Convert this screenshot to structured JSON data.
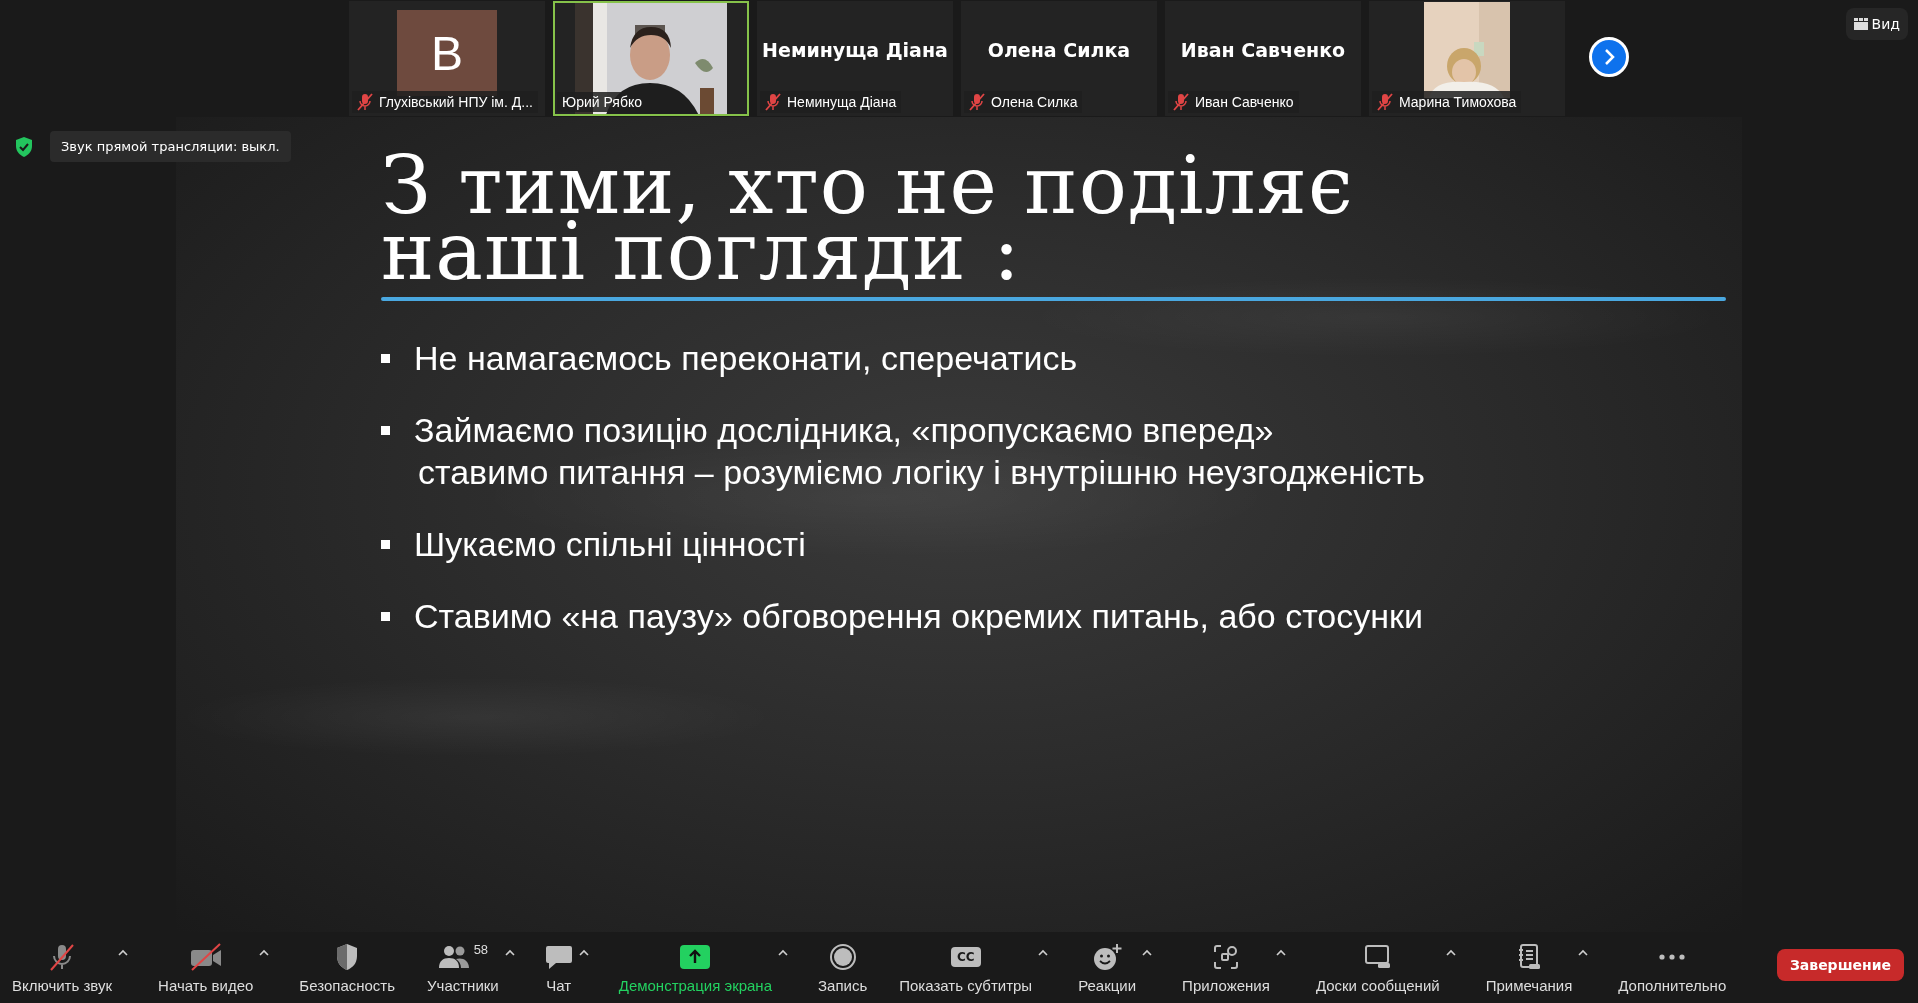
{
  "participants": [
    {
      "kind": "avatar",
      "letter": "B",
      "label": "Глухівський НПУ ім. Д...",
      "muted": true,
      "selected": false
    },
    {
      "kind": "video",
      "label": "Юрий Рябко",
      "muted": false,
      "selected": true
    },
    {
      "kind": "name",
      "display_name": "Неминуща Діана",
      "label": "Неминуща Діана",
      "muted": true,
      "selected": false
    },
    {
      "kind": "name",
      "display_name": "Олена Силка",
      "label": "Олена Силка",
      "muted": true,
      "selected": false
    },
    {
      "kind": "name",
      "display_name": "Иван Савченко",
      "label": "Иван Савченко",
      "muted": true,
      "selected": false
    },
    {
      "kind": "portrait",
      "label": "Марина Тимохова",
      "muted": true,
      "selected": false
    }
  ],
  "view_button": "Вид",
  "notice": "Звук прямой трансляции: выкл.",
  "slide": {
    "title_lines": [
      "З тими, хто не поділяє",
      "наші погляди :"
    ],
    "bullets": [
      {
        "lines": [
          "Не намагаємось переконати, сперечатись"
        ]
      },
      {
        "lines": [
          "Займаємо позицію дослідника, «пропускаємо вперед»",
          "ставимо питання – розуміємо логіку і внутрішню неузгодженість"
        ]
      },
      {
        "lines": [
          "Шукаємо спільні цінності"
        ]
      },
      {
        "lines": [
          "Ставимо «на паузу» обговорення окремих питань, або стосунки"
        ]
      }
    ]
  },
  "toolbar": [
    {
      "kind": "mic-muted",
      "label": "Включить звук",
      "caret": true,
      "highlighted": false
    },
    {
      "kind": "camera-muted",
      "label": "Начать видео",
      "caret": true,
      "highlighted": false
    },
    {
      "kind": "shield",
      "label": "Безопасность",
      "caret": false,
      "highlighted": false
    },
    {
      "kind": "people",
      "label": "Участники",
      "badge": "58",
      "caret": true,
      "highlighted": false
    },
    {
      "kind": "chat",
      "label": "Чат",
      "caret": true,
      "highlighted": false
    },
    {
      "kind": "share",
      "label": "Демонстрация экрана",
      "caret": true,
      "highlighted": true
    },
    {
      "kind": "record",
      "label": "Запись",
      "caret": false,
      "highlighted": false
    },
    {
      "kind": "cc",
      "icon_text": "CC",
      "label": "Показать субтитры",
      "caret": true,
      "highlighted": false
    },
    {
      "kind": "reactions",
      "label": "Реакции",
      "caret": true,
      "highlighted": false
    },
    {
      "kind": "apps",
      "label": "Приложения",
      "caret": true,
      "highlighted": false
    },
    {
      "kind": "whiteboard",
      "label": "Доски сообщений",
      "caret": true,
      "highlighted": false
    },
    {
      "kind": "notes",
      "label": "Примечания",
      "caret": true,
      "highlighted": false
    },
    {
      "kind": "more",
      "label": "Дополнительно",
      "caret": false,
      "highlighted": false
    }
  ],
  "end_button": "Завершение"
}
